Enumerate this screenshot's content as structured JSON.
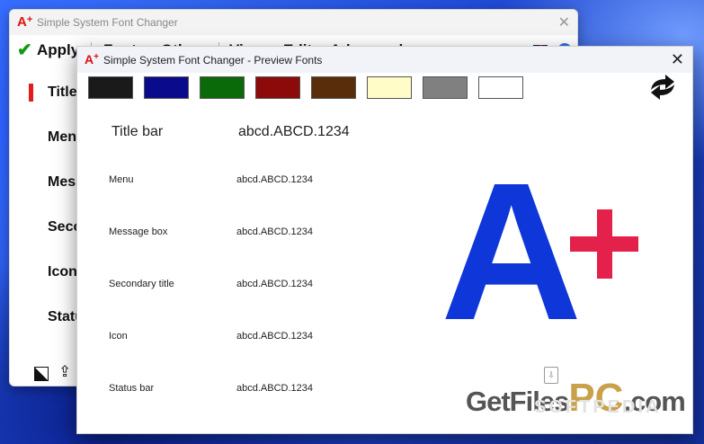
{
  "background_window": {
    "title": "Simple System Font Changer",
    "app_icon": "A+",
    "close_glyph": "✕",
    "apply_label": "Apply",
    "toolbar_tabs": [
      "Font",
      "Other",
      "View",
      "Edit",
      "Advanced"
    ],
    "sidebar_items": [
      "Title",
      "Menu",
      "Message",
      "Secondary",
      "Icon",
      "Status"
    ],
    "help_glyph": "?"
  },
  "preview_window": {
    "title": "Simple System Font Changer - Preview Fonts",
    "app_icon": "A+",
    "close_glyph": "✕",
    "swatches": [
      "#1a1a1a",
      "#0a0a8c",
      "#0a6a0a",
      "#8c0a0a",
      "#5a2d0a",
      "#fffcc8",
      "#808080",
      "#ffffff"
    ],
    "rows": [
      {
        "label": "Title bar",
        "sample": "abcd.ABCD.1234"
      },
      {
        "label": "Menu",
        "sample": "abcd.ABCD.1234"
      },
      {
        "label": "Message box",
        "sample": "abcd.ABCD.1234"
      },
      {
        "label": "Secondary title",
        "sample": "abcd.ABCD.1234"
      },
      {
        "label": "Icon",
        "sample": "abcd.ABCD.1234"
      },
      {
        "label": "Status bar",
        "sample": "abcd.ABCD.1234"
      }
    ],
    "logo": {
      "letter": "A",
      "accent_color": "#e3214a",
      "letter_color": "#0e36d8"
    }
  },
  "watermark": {
    "main": "GetFiles",
    "pc": "PC",
    "suffix": ".com",
    "sub": "SOFTPEDIA"
  }
}
